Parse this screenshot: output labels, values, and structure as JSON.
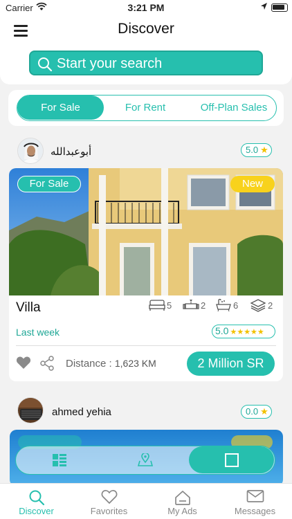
{
  "status_bar": {
    "carrier": "Carrier",
    "time": "3:21 PM"
  },
  "header": {
    "title": "Discover",
    "search_placeholder": "Start your search"
  },
  "tabs": [
    {
      "label": "For Sale",
      "active": true
    },
    {
      "label": "For Rent",
      "active": false
    },
    {
      "label": "Off-Plan Sales",
      "active": false
    }
  ],
  "listings": [
    {
      "user": {
        "name": "أبوعبدالله",
        "rating": "5.0"
      },
      "status": "For Sale",
      "badge": "New",
      "title": "Villa",
      "features": {
        "bedrooms": "5",
        "living_rooms": "2",
        "bathrooms": "6",
        "floors": "2"
      },
      "date": "Last week",
      "rating": "5.0",
      "distance_label": "Distance :",
      "distance_value": "1,623 KM",
      "price": "2 Million SR"
    },
    {
      "user": {
        "name": "ahmed yehia",
        "rating": "0.0"
      }
    }
  ],
  "view_toggle": [
    "list-icon",
    "map-pin-icon",
    "grid-icon"
  ],
  "bottom_nav": [
    {
      "label": "Discover",
      "icon": "search-icon",
      "active": true
    },
    {
      "label": "Favorites",
      "icon": "heart-icon",
      "active": false
    },
    {
      "label": "My Ads",
      "icon": "home-icon",
      "active": false
    },
    {
      "label": "Messages",
      "icon": "mail-icon",
      "active": false
    }
  ],
  "colors": {
    "accent": "#26bfae",
    "badge_yellow": "#f8d21c",
    "star": "#f2c100"
  }
}
